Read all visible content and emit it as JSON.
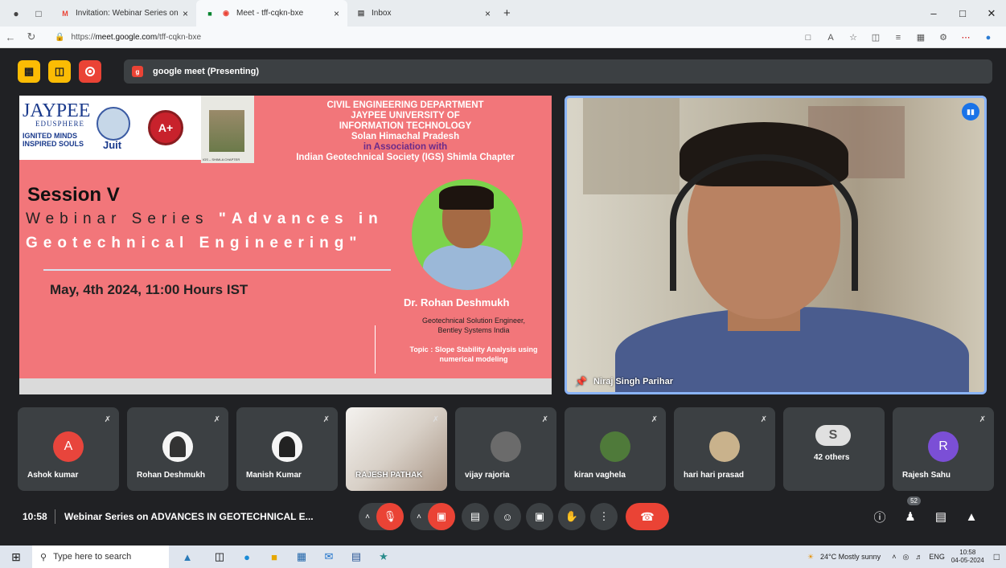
{
  "browser": {
    "tabs": [
      {
        "title": "Invitation: Webinar Series on AD",
        "favicon": "gmail-icon"
      },
      {
        "title": "Meet - tff-cqkn-bxe",
        "favicon": "meet-icon"
      },
      {
        "title": "Inbox",
        "favicon": "inbox-icon"
      }
    ],
    "tab_close": "×",
    "new_tab": "+",
    "url_prefix": "https://",
    "url_host": "meet.google.com",
    "url_path": "/tff-cqkn-bxe"
  },
  "meet": {
    "presenting_label": "google meet (Presenting)",
    "slide": {
      "logo_jaypee": "JAYPEE",
      "logo_edusphere": "EDUSPHERE",
      "logo_tagline1": "IGNITED MINDS",
      "logo_tagline2": "INSPIRED SOULS",
      "logo_juit": "Juit",
      "logo_aplus": "A+",
      "logo_igs_caption": "IGS – SHIMLA CHAPTER",
      "dept_lines": [
        "CIVIL ENGINEERING DEPARTMENT",
        "JAYPEE UNIVERSITY OF",
        "INFORMATION TECHNOLOGY",
        "Solan Himachal Pradesh"
      ],
      "assoc": "in Association with",
      "igs": "Indian Geotechnical Society (IGS) Shimla Chapter",
      "session": "Session V",
      "series_prefix": "Webinar Series ",
      "series_title1": "\"Advances in",
      "series_title2": "Geotechnical Engineering\"",
      "date": "May, 4th 2024, 11:00 Hours IST",
      "speaker_name": "Dr. Rohan Deshmukh",
      "speaker_role1": "Geotechnical Solution Engineer,",
      "speaker_role2": "Bentley Systems India",
      "topic1": "Topic : Slope Stability Analysis using",
      "topic2": "numerical modeling"
    },
    "main_speaker": "Niraj Singh Parihar",
    "participants": [
      {
        "name": "Ashok kumar",
        "initial": "A",
        "color": "#e8453c",
        "type": "initial"
      },
      {
        "name": "Rohan Deshmukh",
        "initial": "",
        "color": "#f5f5f5",
        "type": "photo"
      },
      {
        "name": "Manish Kumar",
        "initial": "",
        "color": "#f5f5f5",
        "type": "photo"
      },
      {
        "name": "RAJESH PATHAK",
        "initial": "",
        "color": "",
        "type": "camera"
      },
      {
        "name": "vijay rajoria",
        "initial": "",
        "color": "#6b6b6b",
        "type": "photo"
      },
      {
        "name": "kiran vaghela",
        "initial": "",
        "color": "#4f7a3a",
        "type": "photo"
      },
      {
        "name": "hari hari prasad",
        "initial": "",
        "color": "#c9b28c",
        "type": "photo"
      },
      {
        "name": "42 others",
        "initial": "S",
        "color": "#e0e0e0",
        "type": "group"
      },
      {
        "name": "Rajesh Sahu",
        "initial": "R",
        "color": "#7b4fd6",
        "type": "initial"
      }
    ],
    "time": "10:58",
    "meeting_name": "Webinar Series on ADVANCES IN GEOTECHNICAL E...",
    "people_count": "52",
    "accent": "#8ab4f8",
    "end_call_color": "#ea4335"
  },
  "taskbar": {
    "search_placeholder": "Type here to search",
    "weather": "24°C  Mostly sunny",
    "lang": "ENG",
    "time": "10:58",
    "date": "04-05-2024"
  }
}
